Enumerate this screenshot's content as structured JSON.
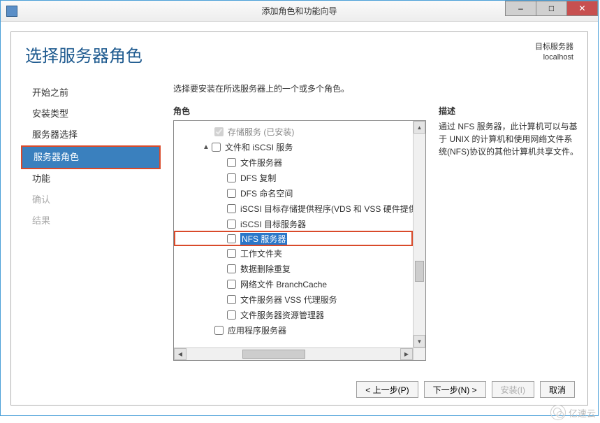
{
  "window": {
    "title": "添加角色和功能向导",
    "minimize": "–",
    "maximize": "□",
    "close": "✕"
  },
  "page": {
    "heading": "选择服务器角色",
    "target_label": "目标服务器",
    "target_value": "localhost",
    "instruction": "选择要安装在所选服务器上的一个或多个角色。",
    "roles_label": "角色",
    "desc_label": "描述",
    "desc_text": "通过 NFS 服务器，此计算机可以与基于 UNIX 的计算机和使用网络文件系统(NFS)协议的其他计算机共享文件。"
  },
  "nav": {
    "items": [
      {
        "label": "开始之前",
        "state": "normal"
      },
      {
        "label": "安装类型",
        "state": "normal"
      },
      {
        "label": "服务器选择",
        "state": "normal"
      },
      {
        "label": "服务器角色",
        "state": "active"
      },
      {
        "label": "功能",
        "state": "normal"
      },
      {
        "label": "确认",
        "state": "disabled"
      },
      {
        "label": "结果",
        "state": "disabled"
      }
    ]
  },
  "tree": {
    "items": [
      {
        "indent": 2,
        "checkbox": true,
        "checked": true,
        "disabled": true,
        "label": "存储服务 (已安装)",
        "installed": true
      },
      {
        "indent": 1,
        "expander": "▲",
        "checkbox": true,
        "checked": false,
        "label": "文件和 iSCSI 服务"
      },
      {
        "indent": 3,
        "checkbox": true,
        "checked": false,
        "label": "文件服务器"
      },
      {
        "indent": 3,
        "checkbox": true,
        "checked": false,
        "label": "DFS 复制"
      },
      {
        "indent": 3,
        "checkbox": true,
        "checked": false,
        "label": "DFS 命名空间"
      },
      {
        "indent": 3,
        "checkbox": true,
        "checked": false,
        "label": "iSCSI 目标存储提供程序(VDS 和 VSS 硬件提供程序)"
      },
      {
        "indent": 3,
        "checkbox": true,
        "checked": false,
        "label": "iSCSI 目标服务器"
      },
      {
        "indent": 3,
        "checkbox": true,
        "checked": false,
        "label": "NFS 服务器",
        "selected": true,
        "highlight": true
      },
      {
        "indent": 3,
        "checkbox": true,
        "checked": false,
        "label": "工作文件夹"
      },
      {
        "indent": 3,
        "checkbox": true,
        "checked": false,
        "label": "数据删除重复"
      },
      {
        "indent": 3,
        "checkbox": true,
        "checked": false,
        "label": "网络文件 BranchCache"
      },
      {
        "indent": 3,
        "checkbox": true,
        "checked": false,
        "label": "文件服务器 VSS 代理服务"
      },
      {
        "indent": 3,
        "checkbox": true,
        "checked": false,
        "label": "文件服务器资源管理器"
      },
      {
        "indent": 2,
        "checkbox": true,
        "checked": false,
        "label": "应用程序服务器"
      }
    ]
  },
  "buttons": {
    "prev": "< 上一步(P)",
    "next": "下一步(N) >",
    "install": "安装(I)",
    "cancel": "取消"
  },
  "watermark": "亿速云"
}
